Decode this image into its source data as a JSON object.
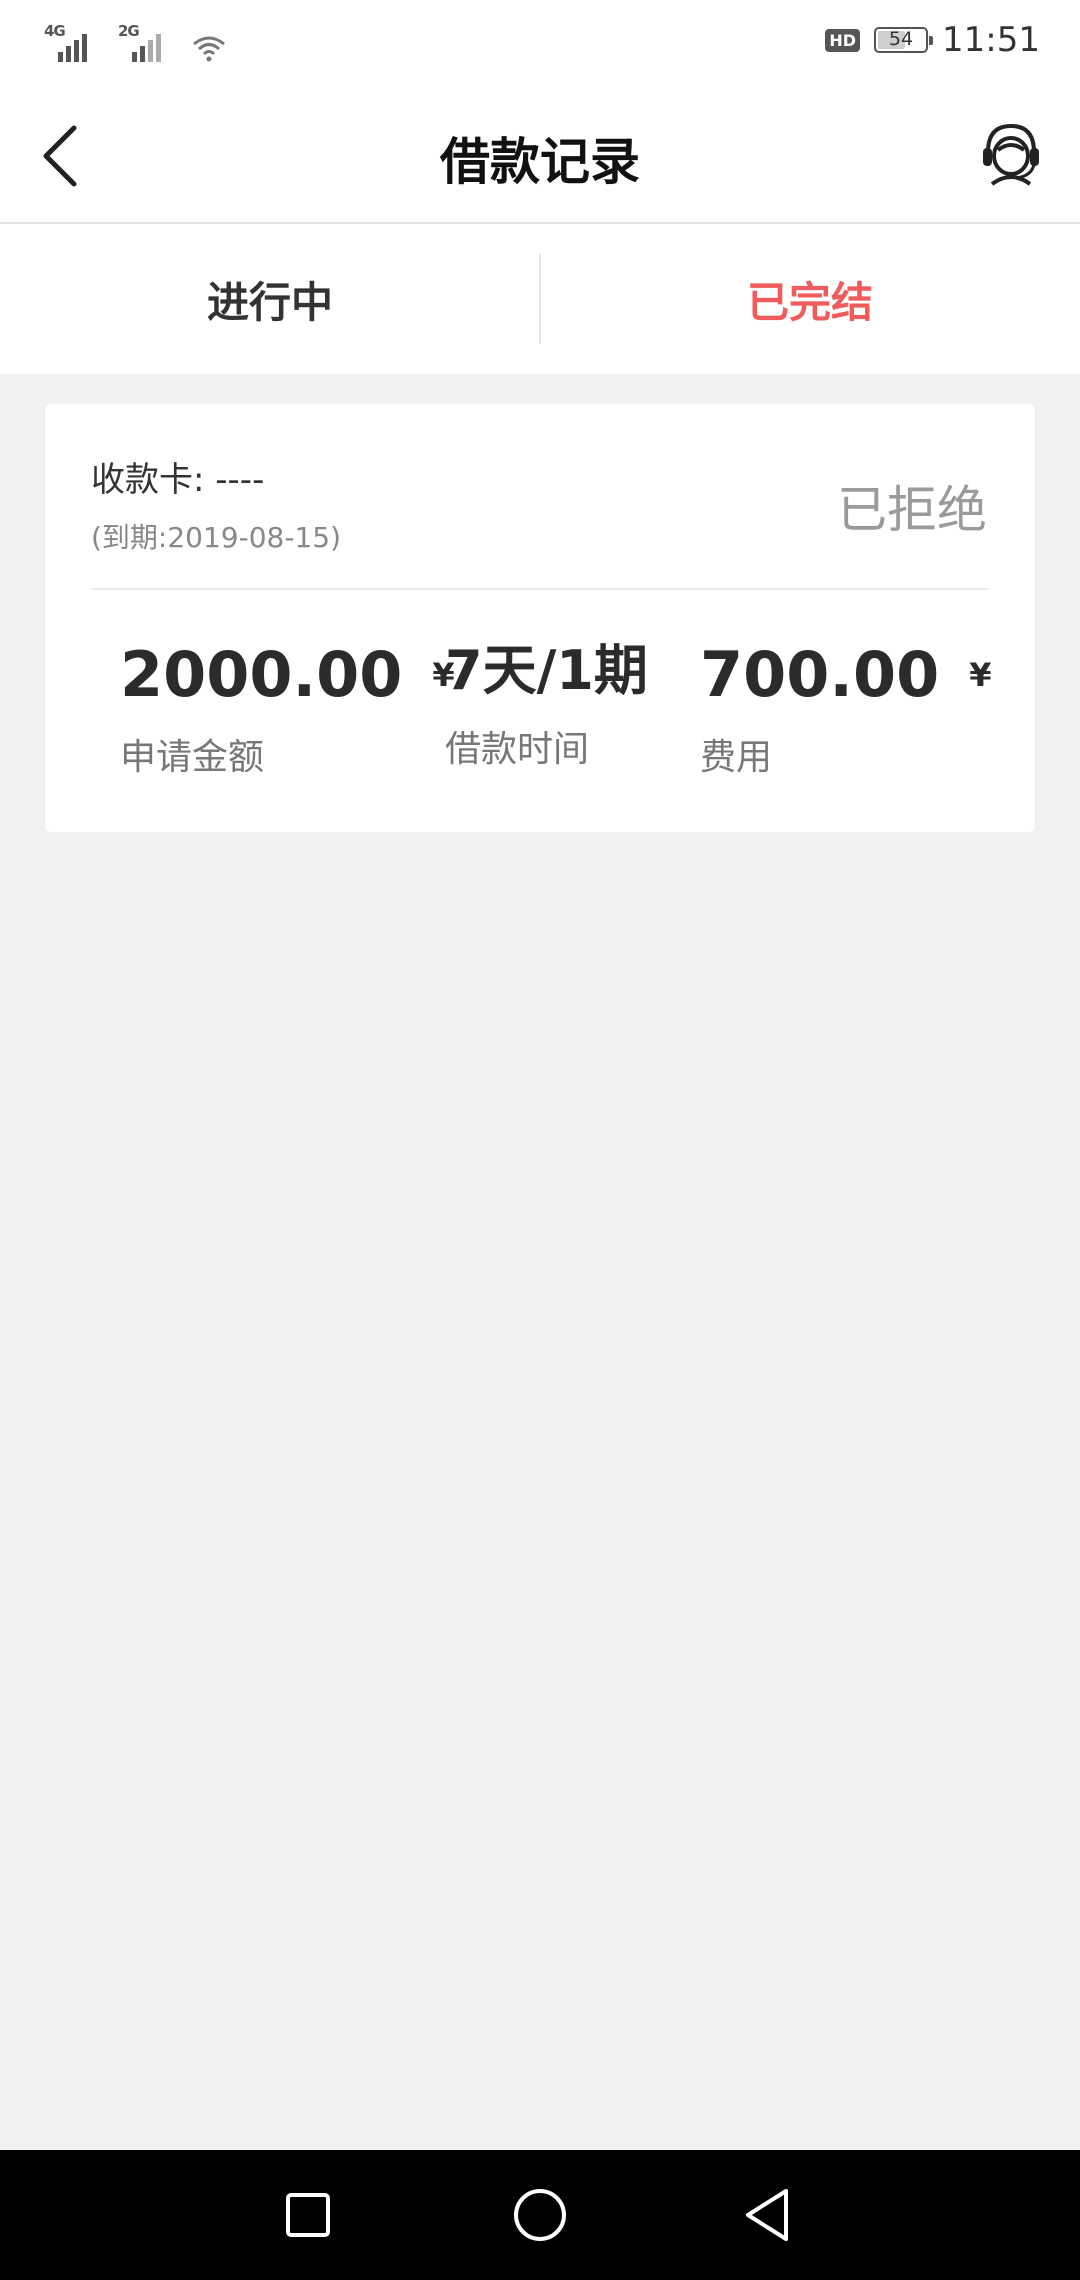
{
  "status_bar": {
    "net1": "4G",
    "net2": "2G",
    "hd": "HD",
    "battery_level": "54",
    "time": "11:51"
  },
  "header": {
    "title": "借款记录"
  },
  "tabs": [
    {
      "label": "进行中",
      "active": false
    },
    {
      "label": "已完结",
      "active": true
    }
  ],
  "record": {
    "card_label": "收款卡: ----",
    "due": "(到期:2019-08-15)",
    "status": "已拒绝",
    "amount": {
      "value": "2000.00",
      "currency": "¥",
      "label": "申请金额"
    },
    "term": {
      "value": "7天/1期",
      "label": "借款时间"
    },
    "fee": {
      "value": "700.00",
      "currency": "¥",
      "label": "费用"
    }
  },
  "colors": {
    "accent": "#f05b5b",
    "background": "#f1f1f1"
  },
  "icons": {
    "back": "back-arrow-icon",
    "service": "customer-service-icon",
    "nav_recent": "square-icon",
    "nav_home": "circle-icon",
    "nav_back": "triangle-back-icon"
  }
}
